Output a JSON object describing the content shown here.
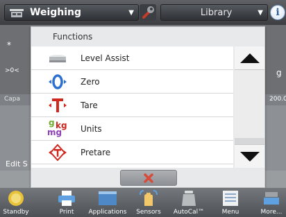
{
  "header": {
    "app_title": "Weighing",
    "library_label": "Library",
    "info_label": "i"
  },
  "background": {
    "star": "*",
    "zero_mark": ">0<",
    "unit": "g",
    "capacity_label": "Capa",
    "capacity_value": "200.00",
    "edit_label": "Edit S"
  },
  "dialog": {
    "title": "Functions",
    "items": [
      {
        "label": "Level Assist",
        "icon": "level-assist-icon"
      },
      {
        "label": "Zero",
        "icon": "zero-icon"
      },
      {
        "label": "Tare",
        "icon": "tare-icon"
      },
      {
        "label": "Units",
        "icon": "units-icon"
      },
      {
        "label": "Pretare",
        "icon": "pretare-icon"
      }
    ],
    "units_icon_text": {
      "top": "g",
      "mid": "kg",
      "bottom": "mg"
    },
    "colors": {
      "accent_blue": "#2b6fd1",
      "accent_red": "#d0271f",
      "close_red": "#d84a3a"
    }
  },
  "toolbar": {
    "items": [
      {
        "label": "Standby",
        "icon": "standby-icon"
      },
      {
        "label": "Print",
        "icon": "print-icon"
      },
      {
        "label": "Applications",
        "icon": "applications-icon"
      },
      {
        "label": "Sensors",
        "icon": "sensors-icon"
      },
      {
        "label": "AutoCal™",
        "icon": "autocal-icon"
      },
      {
        "label": "Menu",
        "icon": "menu-icon"
      },
      {
        "label": "More...",
        "icon": "more-icon"
      }
    ]
  }
}
